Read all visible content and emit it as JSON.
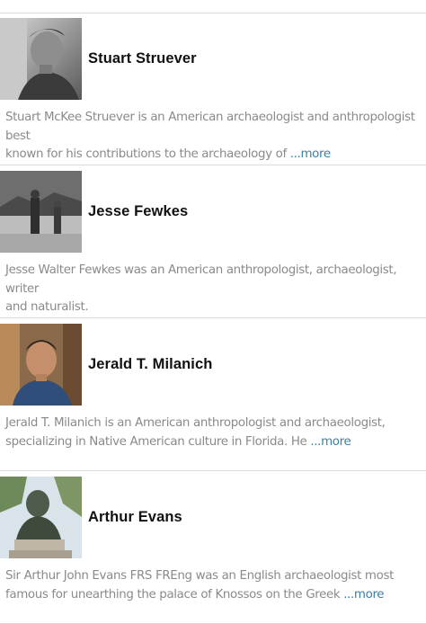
{
  "people": [
    {
      "name": "Stuart Struever",
      "line1": "Stuart McKee Struever is an American archaeologist and anthropologist best",
      "line2": "known for his contributions to the archaeology of ",
      "more": "...more"
    },
    {
      "name": "Jesse Fewkes",
      "line1": "Jesse Walter Fewkes was an American anthropologist, archaeologist, writer",
      "line2": "and naturalist.",
      "more": ""
    },
    {
      "name": "Jerald T. Milanich",
      "line1": "Jerald T. Milanich is an American anthropologist and archaeologist,",
      "line2": "specializing in Native American culture in Florida. He ",
      "more": "...more"
    },
    {
      "name": "Arthur Evans",
      "line1": "Sir Arthur John Evans FRS FREng was an English archaeologist most",
      "line2": "famous for unearthing the palace of Knossos on the Greek ",
      "more": "...more"
    }
  ],
  "colors": {
    "name": "#111111",
    "description": "#8a8a8a",
    "more_link": "#3a7fa8",
    "divider": "#dcdcdc"
  }
}
